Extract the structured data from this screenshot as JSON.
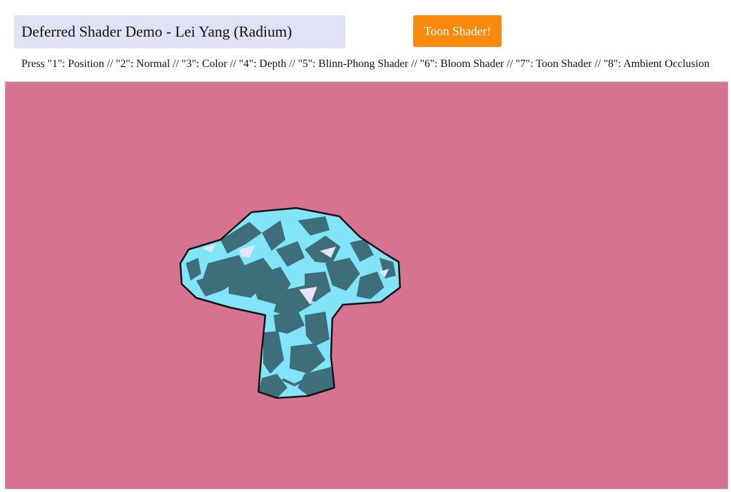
{
  "header": {
    "title": "Deferred Shader Demo - Lei Yang (Radium)",
    "mode_button_label": "Toon Shader!"
  },
  "instructions": {
    "text": "Press \"1\": Position // \"2\": Normal // \"3\": Color // \"4\": Depth // \"5\": Blinn-Phong Shader // \"6\": Bloom Shader // \"7\": Toon Shader // \"8\": Ambient Occlusion"
  },
  "viewport": {
    "background_color": "#d67390",
    "model": "monkey-head",
    "light_tone_color": "#82e4f8",
    "dark_tone_color": "#3f6e7b",
    "highlight_color": "#e6e4f6",
    "outline_color": "#111111"
  }
}
